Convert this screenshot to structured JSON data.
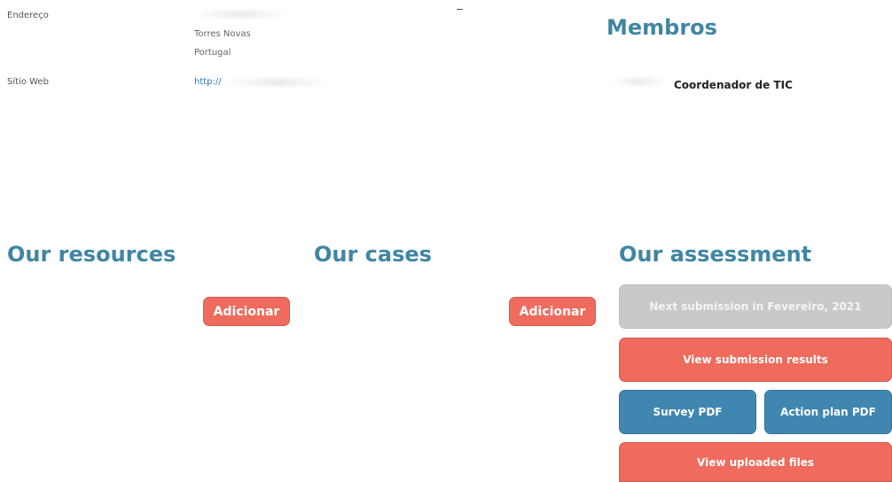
{
  "info": {
    "address_label": "Endereço",
    "address_city": "Torres Novas",
    "address_country": "Portugal",
    "website_label": "Sítio Web",
    "website_value": "http://"
  },
  "members": {
    "title": "Membros",
    "items": [
      {
        "role": "Coordenador de TIC"
      }
    ]
  },
  "resources": {
    "title": "Our resources",
    "add_label": "Adicionar"
  },
  "cases": {
    "title": "Our cases",
    "add_label": "Adicionar"
  },
  "assessment": {
    "title": "Our assessment",
    "next_submission_label": "Next submission in Fevereiro, 2021",
    "view_results_label": "View submission results",
    "survey_pdf_label": "Survey PDF",
    "action_plan_pdf_label": "Action plan PDF",
    "view_files_label": "View uploaded files"
  },
  "colors": {
    "heading": "#3f86a4",
    "coral": "#ee6b5d",
    "blue": "#3f86b0",
    "grey": "#c9c9c9"
  }
}
